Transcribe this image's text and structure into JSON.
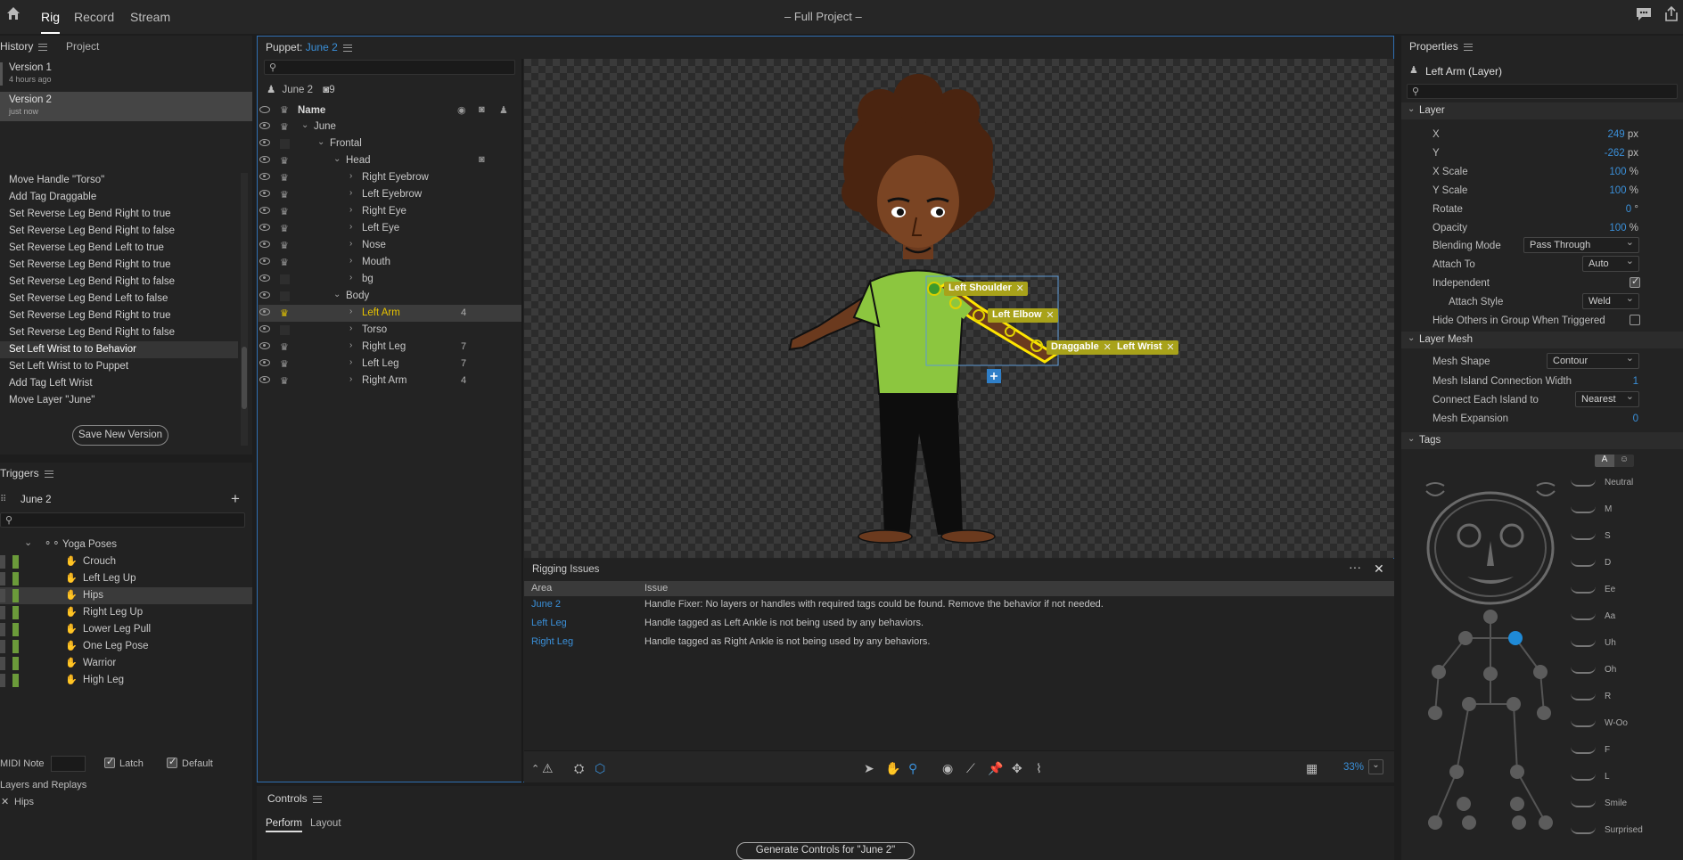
{
  "app": {
    "title": "– Full Project –",
    "tabs": [
      "Rig",
      "Record",
      "Stream"
    ]
  },
  "history": {
    "tabs": [
      "History",
      "Project"
    ],
    "versions": [
      {
        "name": "Version 1",
        "time": "4 hours ago"
      },
      {
        "name": "Version 2",
        "time": "just now"
      }
    ],
    "actions": [
      "Move Handle \"Torso\"",
      "Add Tag Draggable",
      "Set Reverse Leg Bend Right to true",
      "Set Reverse Leg Bend Right to false",
      "Set Reverse Leg Bend Left to true",
      "Set Reverse Leg Bend Right to true",
      "Set Reverse Leg Bend Right to false",
      "Set Reverse Leg Bend Left to false",
      "Set Reverse Leg Bend Right to true",
      "Set Reverse Leg Bend Right to false",
      "Set Left Wrist to to Behavior",
      "Set Left Wrist to to Puppet",
      "Add Tag Left Wrist",
      "Move Layer \"June\""
    ],
    "selected_index": 10,
    "save_button": "Save New Version"
  },
  "triggers": {
    "title": "Triggers",
    "puppet": "June 2",
    "group": "Yoga Poses",
    "items": [
      "Crouch",
      "Left Leg Up",
      "Hips",
      "Right Leg Up",
      "Lower Leg Pull",
      "One Leg Pose",
      "Warrior",
      "High Leg"
    ],
    "selected_index": 2,
    "midi_label": "MIDI Note",
    "latch_label": "Latch",
    "default_label": "Default",
    "layers_label": "Layers and Replays",
    "layer_item": "Hips"
  },
  "puppet": {
    "label": "Puppet:",
    "name": "June 2",
    "crumb_name": "June 2",
    "crumb_count": "9",
    "col_name": "Name",
    "tree": [
      {
        "label": "June",
        "indent": 0,
        "chev": "⌄",
        "crown": true,
        "num": ""
      },
      {
        "label": "Frontal",
        "indent": 1,
        "chev": "⌄",
        "crown": false,
        "num": ""
      },
      {
        "label": "Head",
        "indent": 2,
        "chev": "⌄",
        "crown": true,
        "num": ""
      },
      {
        "label": "Right Eyebrow",
        "indent": 3,
        "chev": "›",
        "crown": true,
        "num": ""
      },
      {
        "label": "Left Eyebrow",
        "indent": 3,
        "chev": "›",
        "crown": true,
        "num": ""
      },
      {
        "label": "Right Eye",
        "indent": 3,
        "chev": "›",
        "crown": true,
        "num": ""
      },
      {
        "label": "Left Eye",
        "indent": 3,
        "chev": "›",
        "crown": true,
        "num": ""
      },
      {
        "label": "Nose",
        "indent": 3,
        "chev": "›",
        "crown": true,
        "num": ""
      },
      {
        "label": "Mouth",
        "indent": 3,
        "chev": "›",
        "crown": true,
        "num": ""
      },
      {
        "label": "bg",
        "indent": 3,
        "chev": "›",
        "crown": false,
        "num": ""
      },
      {
        "label": "Body",
        "indent": 2,
        "chev": "⌄",
        "crown": false,
        "num": ""
      },
      {
        "label": "Left Arm",
        "indent": 3,
        "chev": "›",
        "crown": true,
        "num": "4"
      },
      {
        "label": "Torso",
        "indent": 3,
        "chev": "›",
        "crown": false,
        "num": ""
      },
      {
        "label": "Right Leg",
        "indent": 3,
        "chev": "›",
        "crown": true,
        "num": "7"
      },
      {
        "label": "Left Leg",
        "indent": 3,
        "chev": "›",
        "crown": true,
        "num": "7"
      },
      {
        "label": "Right Arm",
        "indent": 3,
        "chev": "›",
        "crown": true,
        "num": "4"
      }
    ],
    "selected_index": 11
  },
  "canvas": {
    "handle_tags": {
      "left_shoulder": "Left Shoulder",
      "left_elbow": "Left Elbow",
      "draggable": "Draggable",
      "left_wrist": "Left Wrist"
    },
    "zoom": "33%"
  },
  "rigging_issues": {
    "title": "Rigging Issues",
    "col_area": "Area",
    "col_issue": "Issue",
    "rows": [
      {
        "area": "June 2",
        "issue": "Handle Fixer: No layers or handles with required tags could be found. Remove the behavior if not needed."
      },
      {
        "area": "Left Leg",
        "issue": "Handle tagged as Left Ankle is not being used by any behaviors."
      },
      {
        "area": "Right Leg",
        "issue": "Handle tagged as Right Ankle is not being used by any behaviors."
      }
    ]
  },
  "controls": {
    "title": "Controls",
    "tabs": [
      "Perform",
      "Layout"
    ],
    "generate_button": "Generate Controls for \"June 2\""
  },
  "properties": {
    "title": "Properties",
    "layer_name": "Left Arm (Layer)",
    "layer_section": "Layer",
    "fields": [
      {
        "label": "X",
        "value": "249",
        "unit": "px"
      },
      {
        "label": "Y",
        "value": "-262",
        "unit": "px"
      },
      {
        "label": "X Scale",
        "value": "100",
        "unit": "%"
      },
      {
        "label": "Y Scale",
        "value": "100",
        "unit": "%"
      },
      {
        "label": "Rotate",
        "value": "0",
        "unit": "°"
      },
      {
        "label": "Opacity",
        "value": "100",
        "unit": "%"
      }
    ],
    "blending_mode_label": "Blending Mode",
    "blending_mode": "Pass Through",
    "attach_to_label": "Attach To",
    "attach_to": "Auto",
    "independent_label": "Independent",
    "attach_style_label": "Attach Style",
    "attach_style": "Weld",
    "hide_others_label": "Hide Others in Group When Triggered",
    "mesh_section": "Layer Mesh",
    "mesh_shape_label": "Mesh Shape",
    "mesh_shape": "Contour",
    "mesh_island_label": "Mesh Island Connection Width",
    "mesh_island": "1",
    "connect_label": "Connect Each Island to",
    "connect": "Nearest",
    "expansion_label": "Mesh Expansion",
    "expansion": "0",
    "tags_section": "Tags",
    "tag_mode": "A",
    "visemes": [
      "Neutral",
      "M",
      "S",
      "D",
      "Ee",
      "Aa",
      "Uh",
      "Oh",
      "R",
      "W-Oo",
      "F",
      "L",
      "Smile",
      "Surprised"
    ]
  },
  "colors": {
    "accent": "#3a8fd8",
    "handle_tag": "#a8a21a",
    "trigger_bar": "#6b9b3a"
  }
}
